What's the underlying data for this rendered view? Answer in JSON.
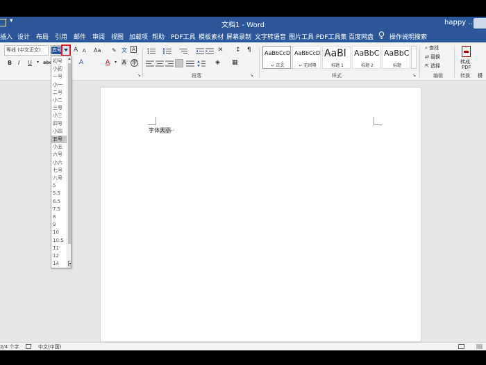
{
  "window": {
    "title": "文档1  -  Word",
    "user": "happy ..",
    "accent": "#2b579a"
  },
  "tabs": [
    {
      "label": "插入"
    },
    {
      "label": "设计"
    },
    {
      "label": "布局"
    },
    {
      "label": "引用"
    },
    {
      "label": "邮件"
    },
    {
      "label": "审阅"
    },
    {
      "label": "视图"
    },
    {
      "label": "加载项"
    },
    {
      "label": "帮助"
    },
    {
      "label": "PDF工具"
    },
    {
      "label": "模板素材"
    },
    {
      "label": "屏幕录制"
    },
    {
      "label": "文字转语音"
    },
    {
      "label": "图片工具"
    },
    {
      "label": "PDF工具集"
    },
    {
      "label": "百度网盘"
    }
  ],
  "tell_me": "操作说明搜索",
  "ribbon": {
    "font": {
      "name": "等线 (中文正文)",
      "size": "五号",
      "grow": "A",
      "shrink": "A",
      "case": "Aa",
      "bold": "B",
      "italic": "I",
      "underline": "U",
      "strike": "abc",
      "sub": "x₂",
      "sup": "x²",
      "effects": "A",
      "color": "A",
      "char_shade": "A",
      "phonetic": "文",
      "border": "A"
    },
    "group_labels": {
      "paragraph": "段落",
      "styles": "样式",
      "editing": "编辑"
    },
    "styles": [
      {
        "preview": "AaBbCcDc",
        "name": "↵ 正文",
        "active": true
      },
      {
        "preview": "AaBbCcDc",
        "name": "↵ 无间隔",
        "active": false
      },
      {
        "preview": "AaBl",
        "name": "标题 1",
        "active": false
      },
      {
        "preview": "AaBbC",
        "name": "标题 2",
        "active": false
      },
      {
        "preview": "AaBbC",
        "name": "标题",
        "active": false
      }
    ],
    "editing": {
      "find": "查找",
      "replace": "替换",
      "select": "选择"
    },
    "side": {
      "convert": "转成",
      "pdf": "PDF",
      "convert_label": "转换",
      "template": "模"
    }
  },
  "document": {
    "text_before": "字体",
    "text_selected": "大小",
    "para_mark": "↵"
  },
  "size_list": {
    "selected": "五号",
    "items": [
      "初号",
      "小初",
      "一号",
      "小一",
      "二号",
      "小二",
      "三号",
      "小三",
      "四号",
      "小四",
      "五号",
      "小五",
      "六号",
      "小六",
      "七号",
      "八号",
      "5",
      "5.5",
      "6.5",
      "7.5",
      "8",
      "9",
      "10",
      "10.5",
      "11",
      "12",
      "14"
    ]
  },
  "status": {
    "word_count": "2/4 个字",
    "language": "中文(中国)"
  }
}
